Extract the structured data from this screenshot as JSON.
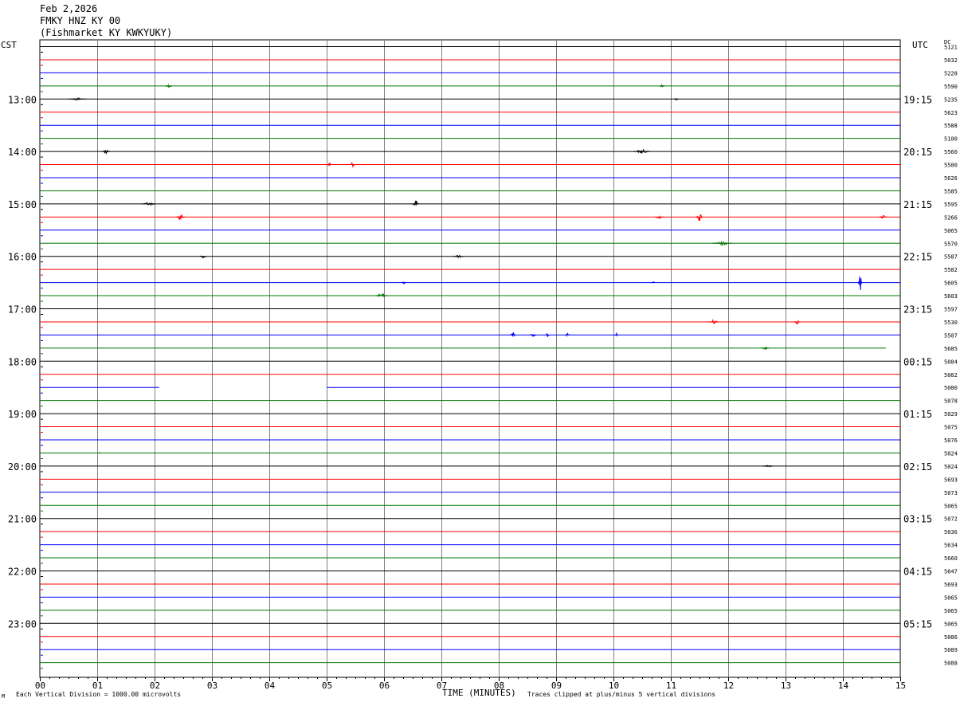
{
  "header": {
    "date": "Feb 2,2026",
    "station": "FMKY HNZ KY 00",
    "location": "(Fishmarket KY KWKYUKY)"
  },
  "labels": {
    "left_tz": "CST",
    "right_tz": "UTC",
    "dc_label": "DC",
    "scale_note": "Each Vertical Division = 1000.00 microvolts",
    "clip_note": "Traces clipped at plus/minus 5 vertical divisions",
    "x_axis_label": "TIME (MINUTES)",
    "corner_mark": "M"
  },
  "colors": {
    "trace_cycle": [
      "#000000",
      "#ff0000",
      "#0000ff",
      "#007700"
    ],
    "grid": "#808080",
    "background": "#ffffff"
  },
  "chart_data": {
    "type": "line",
    "title": "FMKY HNZ KY 00",
    "xlabel": "TIME (MINUTES)",
    "ylabel": "",
    "xlim": [
      0,
      15
    ],
    "x_ticks": [
      "00",
      "01",
      "02",
      "03",
      "04",
      "05",
      "06",
      "07",
      "08",
      "09",
      "10",
      "11",
      "12",
      "13",
      "14",
      "15"
    ],
    "left_hour_labels": [
      "13:00",
      "14:00",
      "15:00",
      "16:00",
      "17:00",
      "18:00",
      "19:00",
      "20:00",
      "21:00",
      "22:00",
      "23:00"
    ],
    "right_hour_labels": [
      "19:15",
      "20:15",
      "21:15",
      "22:15",
      "23:15",
      "00:15",
      "01:15",
      "02:15",
      "03:15",
      "04:15",
      "05:15"
    ],
    "first_hour_row_index": 4,
    "rows_per_hour": 4,
    "row_count": 48,
    "dc_values": [
      "5121",
      "5032",
      "5228",
      "5590",
      "5235",
      "5623",
      "5588",
      "5100",
      "5560",
      "5580",
      "5626",
      "5585",
      "5595",
      "5266",
      "5065",
      "5570",
      "5587",
      "5582",
      "5605",
      "5603",
      "5597",
      "5530",
      "5507",
      "5685",
      "5084",
      "5082",
      "5080",
      "5078",
      "5029",
      "5075",
      "5076",
      "5024",
      "5024",
      "5693",
      "5073",
      "5065",
      "5072",
      "5036",
      "5634",
      "5660",
      "5647",
      "5693",
      "5065",
      "5065",
      "5065",
      "5086",
      "5089",
      "5088"
    ],
    "gaps": [
      {
        "row": 26,
        "from_min": 2.08,
        "to_min": 5.0
      },
      {
        "row": 23,
        "from_min": 14.75,
        "to_min": 15.0
      }
    ],
    "events": [
      {
        "row": 3,
        "minute": 2.25,
        "amp": 2,
        "width": 0.12
      },
      {
        "row": 3,
        "minute": 10.85,
        "amp": 2,
        "width": 0.1
      },
      {
        "row": 4,
        "minute": 0.65,
        "amp": 1.5,
        "width": 0.3
      },
      {
        "row": 4,
        "minute": 11.1,
        "amp": 2,
        "width": 0.08
      },
      {
        "row": 8,
        "minute": 1.15,
        "amp": 3,
        "width": 0.15
      },
      {
        "row": 8,
        "minute": 10.5,
        "amp": 2.5,
        "width": 0.3
      },
      {
        "row": 9,
        "minute": 5.05,
        "amp": 3,
        "width": 0.08
      },
      {
        "row": 9,
        "minute": 5.45,
        "amp": 3,
        "width": 0.1
      },
      {
        "row": 12,
        "minute": 1.9,
        "amp": 2,
        "width": 0.25
      },
      {
        "row": 12,
        "minute": 6.55,
        "amp": 4,
        "width": 0.15
      },
      {
        "row": 13,
        "minute": 2.45,
        "amp": 4,
        "width": 0.15
      },
      {
        "row": 13,
        "minute": 10.8,
        "amp": 2,
        "width": 0.15
      },
      {
        "row": 13,
        "minute": 11.5,
        "amp": 6,
        "width": 0.12
      },
      {
        "row": 13,
        "minute": 14.7,
        "amp": 2.5,
        "width": 0.15
      },
      {
        "row": 15,
        "minute": 11.9,
        "amp": 2.5,
        "width": 0.35
      },
      {
        "row": 16,
        "minute": 2.85,
        "amp": 2,
        "width": 0.12
      },
      {
        "row": 16,
        "minute": 7.3,
        "amp": 1.5,
        "width": 0.18
      },
      {
        "row": 18,
        "minute": 6.35,
        "amp": 2,
        "width": 0.08
      },
      {
        "row": 18,
        "minute": 10.7,
        "amp": 1.5,
        "width": 0.06
      },
      {
        "row": 18,
        "minute": 14.3,
        "amp": 13,
        "width": 0.07
      },
      {
        "row": 19,
        "minute": 5.95,
        "amp": 2.5,
        "width": 0.25
      },
      {
        "row": 21,
        "minute": 11.75,
        "amp": 2.5,
        "width": 0.2
      },
      {
        "row": 21,
        "minute": 13.2,
        "amp": 3,
        "width": 0.12
      },
      {
        "row": 22,
        "minute": 8.25,
        "amp": 3,
        "width": 0.1
      },
      {
        "row": 22,
        "minute": 8.6,
        "amp": 3,
        "width": 0.12
      },
      {
        "row": 22,
        "minute": 8.85,
        "amp": 2.5,
        "width": 0.08
      },
      {
        "row": 22,
        "minute": 9.2,
        "amp": 2,
        "width": 0.08
      },
      {
        "row": 22,
        "minute": 10.05,
        "amp": 2,
        "width": 0.06
      },
      {
        "row": 23,
        "minute": 12.65,
        "amp": 1.5,
        "width": 0.15
      },
      {
        "row": 31,
        "minute": 1.05,
        "amp": 1,
        "width": 0.05
      },
      {
        "row": 31,
        "minute": 11.0,
        "amp": 1,
        "width": 0.03
      },
      {
        "row": 32,
        "minute": 12.7,
        "amp": 1,
        "width": 0.2
      }
    ]
  }
}
